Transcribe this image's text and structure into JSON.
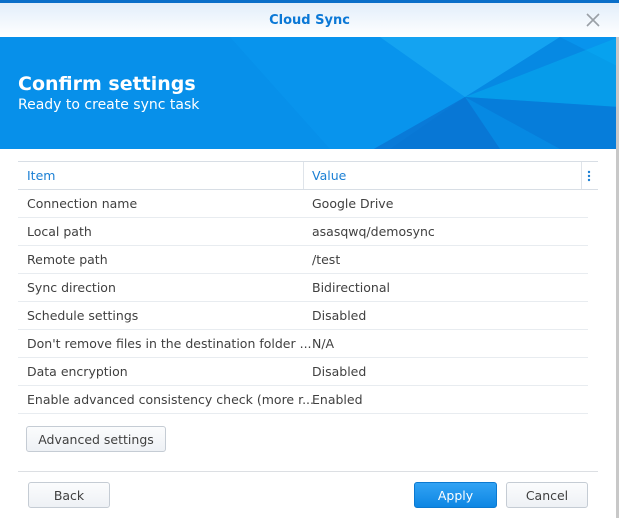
{
  "window": {
    "title": "Cloud Sync",
    "accent": "#0790ea"
  },
  "banner": {
    "title": "Confirm settings",
    "subtitle": "Ready to create sync task"
  },
  "table": {
    "columns": [
      "Item",
      "Value"
    ],
    "rows": [
      {
        "item": "Connection name",
        "value": "Google Drive"
      },
      {
        "item": "Local path",
        "value": "asasqwq/demosync"
      },
      {
        "item": "Remote path",
        "value": "/test"
      },
      {
        "item": "Sync direction",
        "value": "Bidirectional"
      },
      {
        "item": "Schedule settings",
        "value": "Disabled"
      },
      {
        "item": "Don't remove files in the destination folder ...",
        "value": "N/A"
      },
      {
        "item": "Data encryption",
        "value": "Disabled"
      },
      {
        "item": "Enable advanced consistency check (more r...",
        "value": "Enabled"
      }
    ]
  },
  "buttons": {
    "advanced": "Advanced settings",
    "back": "Back",
    "apply": "Apply",
    "cancel": "Cancel"
  }
}
